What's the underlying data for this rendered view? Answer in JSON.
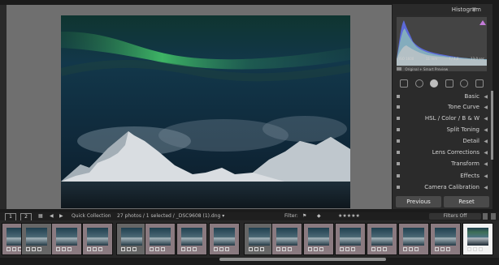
{
  "panel": {
    "histogram_title": "Histogram",
    "exif": {
      "iso": "ISO 1600",
      "focal": "11 mm",
      "aperture": "f / 4,0",
      "shutter": "13,0 sec"
    },
    "preview_text": "Original + Smart Preview",
    "sections": [
      {
        "label": "Basic"
      },
      {
        "label": "Tone Curve"
      },
      {
        "label": "HSL / Color / B & W"
      },
      {
        "label": "Split Toning"
      },
      {
        "label": "Detail"
      },
      {
        "label": "Lens Corrections"
      },
      {
        "label": "Transform"
      },
      {
        "label": "Effects"
      },
      {
        "label": "Camera Calibration"
      }
    ],
    "buttons": {
      "previous": "Previous",
      "reset": "Reset"
    }
  },
  "bottombar": {
    "views": [
      "1",
      "2"
    ],
    "collection": "Quick Collection",
    "status": "27 photos / 1 selected / _DSC9608 (1).dng ▾",
    "filter_label": "Filter:",
    "filters_off": "Filters Off"
  },
  "filmstrip": {
    "count": 15,
    "selected_index": 14
  },
  "colors": {
    "background": "#1b1b1b",
    "panel": "#2b2b2b",
    "canvas": "#6f6f6f",
    "aurora": "#3fbf62"
  }
}
